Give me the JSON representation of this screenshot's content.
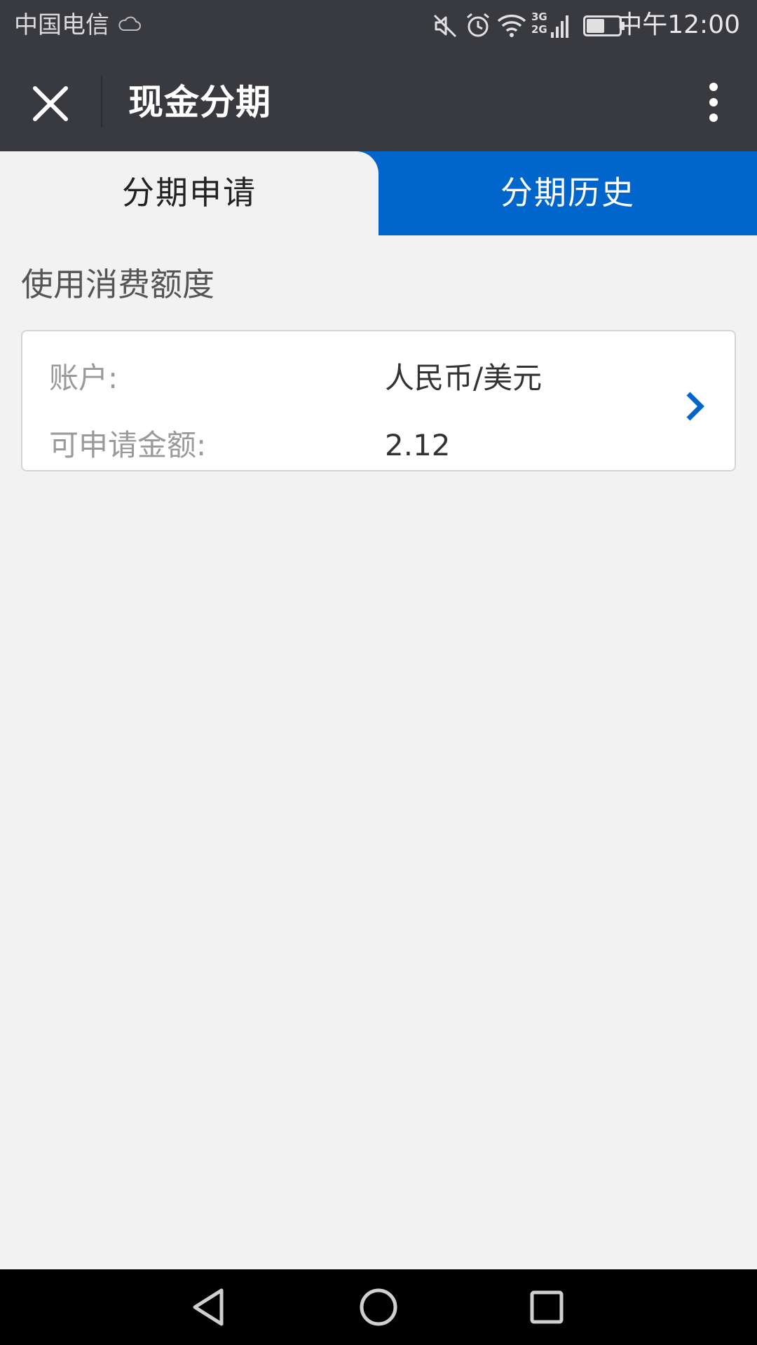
{
  "status_bar": {
    "carrier": "中国电信",
    "network_label_top": "3G",
    "network_label_bottom": "2G",
    "time": "中午12:00",
    "icons": [
      "cloud-icon",
      "mute-icon",
      "alarm-icon",
      "wifi-icon",
      "signal-icon",
      "battery-icon"
    ],
    "battery_level": 0.55
  },
  "title_bar": {
    "title": "现金分期",
    "close_icon": "close-icon",
    "more_icon": "more-vertical-icon"
  },
  "tabs": [
    {
      "label": "分期申请",
      "active": true
    },
    {
      "label": "分期历史",
      "active": false
    }
  ],
  "section": {
    "title": "使用消费额度"
  },
  "account_card": {
    "account_label": "账户:",
    "account_value": "人民币/美元",
    "amount_label": "可申请金额:",
    "amount_value": "2.12",
    "chevron_icon": "chevron-right-icon"
  },
  "nav_bar": {
    "icons": [
      "back-triangle-icon",
      "home-circle-icon",
      "recents-square-icon"
    ]
  },
  "colors": {
    "header_bg": "#393a3f",
    "accent": "#0066cc",
    "page_bg": "#f2f2f2"
  }
}
